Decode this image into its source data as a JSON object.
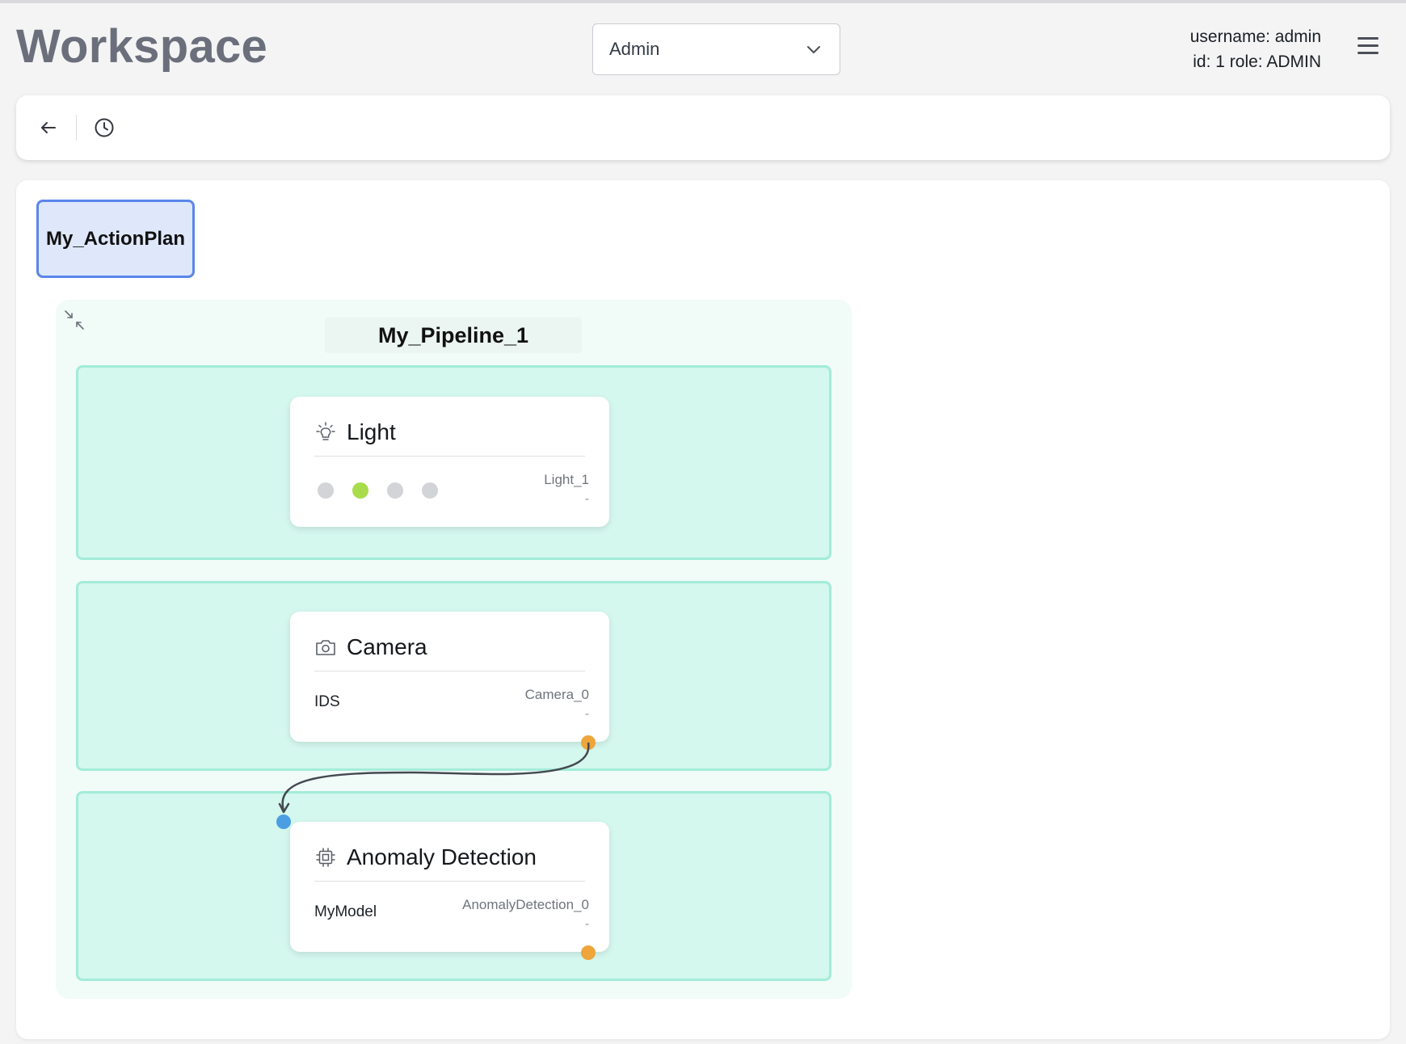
{
  "header": {
    "title": "Workspace",
    "role_select": {
      "value": "Admin"
    },
    "user": {
      "username_line": "username: admin",
      "id_role_line": "id: 1 role: ADMIN"
    }
  },
  "toolbar": {
    "back_icon": "arrow-left-icon",
    "history_icon": "clock-icon"
  },
  "canvas": {
    "action_plan": {
      "label": "My_ActionPlan",
      "border_color": "#5b86ea",
      "fill_color": "#dfe8fb"
    },
    "pipeline": {
      "title": "My_Pipeline_1",
      "collapse_icon": "collapse-arrows-icon",
      "stage_color": "#d4f7ee",
      "stage_border_color": "#a2ecd8",
      "nodes": [
        {
          "title": "Light",
          "icon": "lightbulb-icon",
          "id": "Light_1",
          "dash": "-",
          "indicators": [
            {
              "state": "off",
              "color": "#d2d4d8"
            },
            {
              "state": "on",
              "color": "#a8dc4a"
            },
            {
              "state": "off",
              "color": "#d2d4d8"
            },
            {
              "state": "off",
              "color": "#d2d4d8"
            }
          ]
        },
        {
          "title": "Camera",
          "icon": "camera-icon",
          "subtitle": "IDS",
          "id": "Camera_0",
          "dash": "-",
          "output_port_color": "#eda53c"
        },
        {
          "title": "Anomaly Detection",
          "icon": "chip-icon",
          "subtitle": "MyModel",
          "id": "AnomalyDetection_0",
          "dash": "-",
          "input_port_color": "#4b9ee3",
          "output_port_color": "#eda53c"
        }
      ],
      "connections": [
        {
          "from": "Camera_0",
          "to": "AnomalyDetection_0"
        }
      ]
    }
  }
}
